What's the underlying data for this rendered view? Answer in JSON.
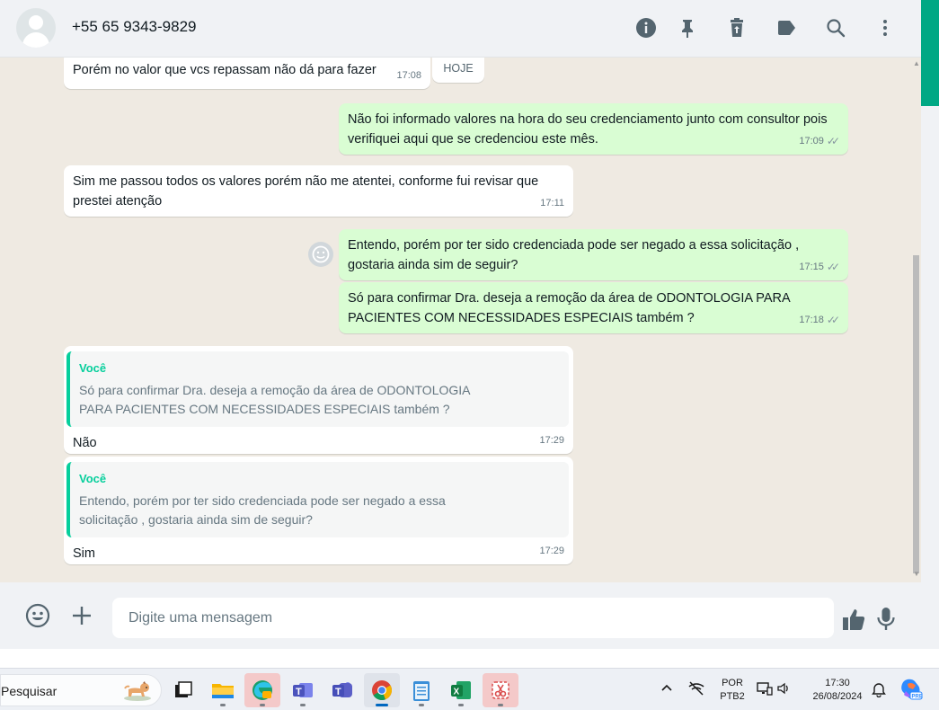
{
  "header": {
    "contact_name": "+55 65 9343-9829",
    "icons": [
      "info-icon",
      "pin-icon",
      "delete-icon",
      "label-icon",
      "search-icon",
      "menu-icon"
    ]
  },
  "chat": {
    "date_chip": "HOJE",
    "messages": [
      {
        "direction": "in",
        "text": "Porém no valor que vcs repassam não dá para fazer",
        "time": "17:08"
      },
      {
        "direction": "out",
        "text": "Não foi informado valores na hora do seu credenciamento junto com consultor pois verifiquei aqui que se credenciou este mês.",
        "time": "17:09"
      },
      {
        "direction": "in",
        "text": "Sim me passou todos os valores porém não me atentei, conforme fui revisar que prestei atenção",
        "time": "17:11"
      },
      {
        "direction": "out",
        "text": "Entendo, porém por ter sido credenciada pode ser negado a essa solicitação , gostaria ainda sim de seguir?",
        "time": "17:15"
      },
      {
        "direction": "out",
        "text": "Só para confirmar Dra. deseja a remoção da área de  ODONTOLOGIA PARA PACIENTES COM NECESSIDADES ESPECIAIS também ?",
        "time": "17:18"
      },
      {
        "direction": "in",
        "quote_author": "Você",
        "quote_text": "Só para confirmar Dra. deseja a remoção da área de  ODONTOLOGIA PARA PACIENTES COM NECESSIDADES ESPECIAIS também ?",
        "text": "Não",
        "time": "17:29"
      },
      {
        "direction": "in",
        "quote_author": "Você",
        "quote_text": "Entendo, porém por ter sido credenciada pode ser negado a essa solicitação , gostaria ainda sim de seguir?",
        "text": "Sim",
        "time": "17:29"
      }
    ]
  },
  "footer": {
    "input_placeholder": "Digite uma mensagem",
    "icons": [
      "emoji-icon",
      "attach-plus-icon",
      "thumbs-up-icon",
      "microphone-icon"
    ]
  },
  "taskbar": {
    "search_label": "Pesquisar",
    "apps": [
      "task-view",
      "file-explorer",
      "edge-dev",
      "teams-classic",
      "teams",
      "chrome",
      "notepad",
      "excel",
      "snipping-tool"
    ],
    "language_line1": "POR",
    "language_line2": "PTB2",
    "time": "17:30",
    "date": "26/08/2024",
    "colors": {
      "accent": "#00a884",
      "bubble_out": "#d9fdd3",
      "quote_bar": "#06cf9c"
    }
  }
}
